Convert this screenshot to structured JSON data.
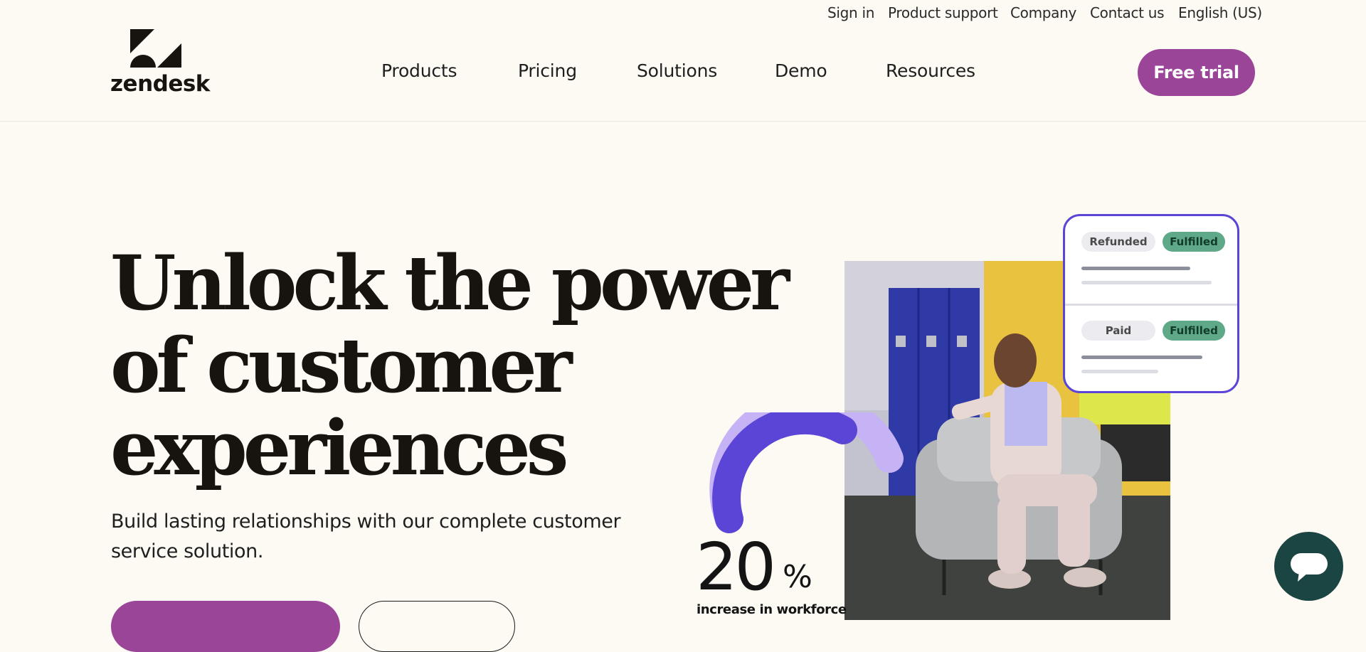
{
  "utility_nav": {
    "sign_in": "Sign in",
    "product_support": "Product support",
    "company": "Company",
    "contact_us": "Contact us",
    "language": "English (US)"
  },
  "brand": {
    "wordmark": "zendesk"
  },
  "main_nav": {
    "products": "Products",
    "pricing": "Pricing",
    "solutions": "Solutions",
    "demo": "Demo",
    "resources": "Resources",
    "free_trial": "Free trial"
  },
  "hero": {
    "title_line1": "Unlock the power",
    "title_line2": "of customer",
    "title_line3": "experiences",
    "subtitle": "Build lasting relationships with our complete customer service solution."
  },
  "status_card": {
    "row1": {
      "left": "Refunded",
      "right": "Fulfilled"
    },
    "row2": {
      "left": "Paid",
      "right": "Fulfilled"
    }
  },
  "stat": {
    "number": "20",
    "unit": "%",
    "caption": "increase in workforce",
    "gauge_fraction": 0.35
  },
  "colors": {
    "brand_purple": "#9a4598",
    "gauge_violet": "#5a45d6",
    "gauge_light": "#c6b3f5",
    "status_green": "#5fa989",
    "chat_teal": "#1b4543",
    "background": "#fdf9f3"
  },
  "icons": {
    "logo": "zendesk-logo-icon",
    "chat": "chat-bubble-icon"
  }
}
